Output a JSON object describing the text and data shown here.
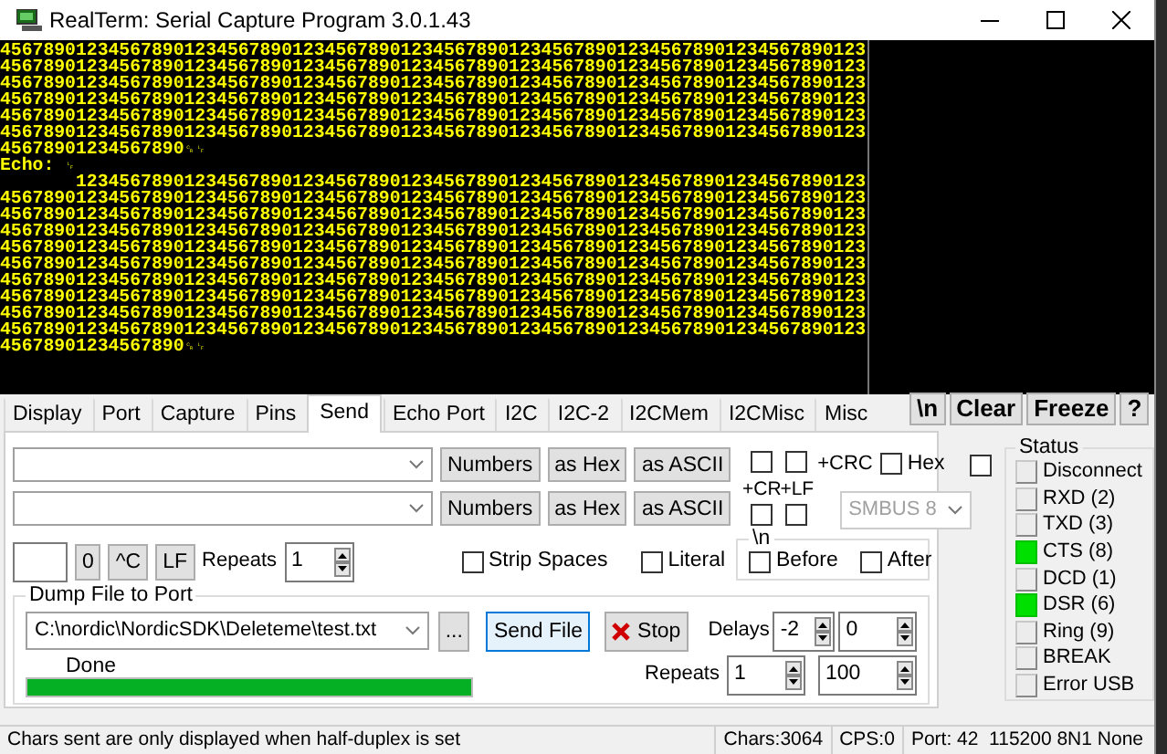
{
  "window": {
    "title": "RealTerm: Serial Capture Program 3.0.1.43"
  },
  "terminal": {
    "lines": [
      {
        "text": "45678901234567890123456789012345678901234567890123456789012345678901234567890123"
      },
      {
        "text": "45678901234567890123456789012345678901234567890123456789012345678901234567890123"
      },
      {
        "text": "45678901234567890123456789012345678901234567890123456789012345678901234567890123"
      },
      {
        "text": "45678901234567890123456789012345678901234567890123456789012345678901234567890123"
      },
      {
        "text": "45678901234567890123456789012345678901234567890123456789012345678901234567890123"
      },
      {
        "text": "45678901234567890123456789012345678901234567890123456789012345678901234567890123"
      },
      {
        "text": "45678901234567890",
        "end": "␍␊"
      },
      {
        "text": "Echo: ",
        "end": "␊"
      },
      {
        "text": "       1234567890123456789012345678901234567890123456789012345678901234567890123"
      },
      {
        "text": "45678901234567890123456789012345678901234567890123456789012345678901234567890123"
      },
      {
        "text": "45678901234567890123456789012345678901234567890123456789012345678901234567890123"
      },
      {
        "text": "45678901234567890123456789012345678901234567890123456789012345678901234567890123"
      },
      {
        "text": "45678901234567890123456789012345678901234567890123456789012345678901234567890123"
      },
      {
        "text": "45678901234567890123456789012345678901234567890123456789012345678901234567890123"
      },
      {
        "text": "45678901234567890123456789012345678901234567890123456789012345678901234567890123"
      },
      {
        "text": "45678901234567890123456789012345678901234567890123456789012345678901234567890123"
      },
      {
        "text": "45678901234567890123456789012345678901234567890123456789012345678901234567890123"
      },
      {
        "text": "45678901234567890123456789012345678901234567890123456789012345678901234567890123"
      },
      {
        "text": "45678901234567890",
        "end": "␍␊"
      }
    ]
  },
  "tabs": [
    {
      "label": "Display",
      "selected": false
    },
    {
      "label": "Port",
      "selected": false
    },
    {
      "label": "Capture",
      "selected": false
    },
    {
      "label": "Pins",
      "selected": false
    },
    {
      "label": "Send",
      "selected": true
    },
    {
      "label": "Echo Port",
      "selected": false
    },
    {
      "label": "I2C",
      "selected": false
    },
    {
      "label": "I2C-2",
      "selected": false
    },
    {
      "label": "I2CMem",
      "selected": false
    },
    {
      "label": "I2CMisc",
      "selected": false
    },
    {
      "label": "Misc",
      "selected": false
    }
  ],
  "toolbar_buttons": [
    "\\n",
    "Clear",
    "Freeze",
    "?"
  ],
  "send": {
    "lines": [
      {
        "buttons": [
          "Numbers",
          "as Hex",
          "as ASCII"
        ],
        "cr_checked": false,
        "lf_checked": false
      },
      {
        "buttons": [
          "Numbers",
          "as Hex",
          "as ASCII"
        ],
        "cr_checked": false,
        "lf_checked": false
      }
    ],
    "cr_label": "+CR",
    "lf_label": "+LF",
    "crc_label": "+CRC",
    "hex": {
      "label": "Hex",
      "checked": false
    },
    "extra_checked": false,
    "smbus": {
      "value": "SMBUS 8",
      "disabled": true
    },
    "char_buttons": [
      "0",
      "^C",
      "LF"
    ],
    "repeats": {
      "label": "Repeats",
      "value": "1"
    },
    "strip_spaces": {
      "label": "Strip Spaces",
      "checked": false
    },
    "literal": {
      "label": "Literal",
      "checked": false
    },
    "newline_group": {
      "title": "\\n",
      "options": [
        {
          "label": "Before",
          "checked": false
        },
        {
          "label": "After",
          "checked": false
        }
      ]
    },
    "dump": {
      "title": "Dump File to Port",
      "path": "C:\\nordic\\NordicSDK\\Deleteme\\test.txt",
      "browse": "...",
      "send_file": {
        "label": "Send File",
        "focused": true
      },
      "stop": "Stop",
      "status": "Done",
      "level": 1,
      "delays": {
        "label": "Delays",
        "values": [
          "-2",
          "0"
        ]
      },
      "repeats": {
        "label": "Repeats",
        "values": [
          "1",
          "100"
        ]
      }
    }
  },
  "status": {
    "title": "Status",
    "items": [
      {
        "label": "Disconnect",
        "on": false
      },
      {
        "label": "RXD (2)",
        "on": false
      },
      {
        "label": "TXD (3)",
        "on": false
      },
      {
        "label": "CTS (8)",
        "on": true
      },
      {
        "label": "DCD (1)",
        "on": false
      },
      {
        "label": "DSR (6)",
        "on": true
      },
      {
        "label": "Ring (9)",
        "on": false
      },
      {
        "label": "BREAK",
        "on": false
      },
      {
        "label": "Error USB",
        "on": false
      }
    ]
  },
  "status_bar": [
    "Chars sent are only displayed when half-duplex is set",
    "Chars:3064",
    "CPS:0",
    "Port: 42  115200 8N1 None"
  ]
}
